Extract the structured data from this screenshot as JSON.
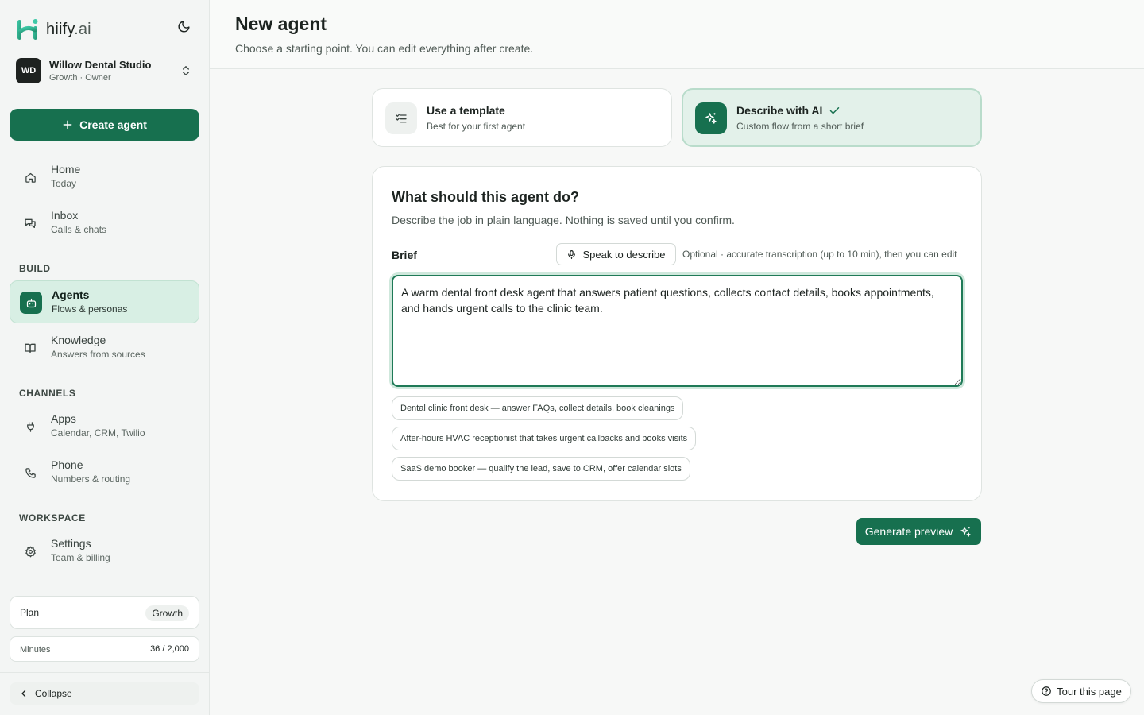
{
  "brand": {
    "name": "hiify",
    "tld": ".ai",
    "accent": "#17704f"
  },
  "workspace": {
    "initials": "WD",
    "name": "Willow Dental Studio",
    "subtitle": "Growth · Owner"
  },
  "sidebar": {
    "create_label": "Create agent",
    "nav": [
      {
        "title": "Home",
        "subtitle": "Today",
        "icon": "home-icon"
      },
      {
        "title": "Inbox",
        "subtitle": "Calls & chats",
        "icon": "chat-icon"
      },
      {
        "title": "Agents",
        "subtitle": "Flows & personas",
        "icon": "bot-icon",
        "active": true
      },
      {
        "title": "Knowledge",
        "subtitle": "Answers from sources",
        "icon": "book-icon"
      },
      {
        "title": "Apps",
        "subtitle": "Calendar, CRM, Twilio",
        "icon": "plug-icon"
      },
      {
        "title": "Phone",
        "subtitle": "Numbers & routing",
        "icon": "phone-icon"
      },
      {
        "title": "Settings",
        "subtitle": "Team & billing",
        "icon": "gear-icon"
      }
    ],
    "sections": {
      "build": "BUILD",
      "channels": "CHANNELS",
      "workspace": "WORKSPACE"
    },
    "plan": {
      "label": "Plan",
      "value": "Growth"
    },
    "minutes": {
      "label": "Minutes",
      "value": "36 / 2,000"
    },
    "collapse_label": "Collapse"
  },
  "header": {
    "title": "New agent",
    "subtitle": "Choose a starting point. You can edit everything after create."
  },
  "modes": [
    {
      "title": "Use a template",
      "subtitle": "Best for your first agent",
      "icon": "checklist-icon",
      "selected": false
    },
    {
      "title": "Describe with AI",
      "subtitle": "Custom flow from a short brief",
      "icon": "sparkle-icon",
      "selected": true
    }
  ],
  "brief": {
    "heading": "What should this agent do?",
    "description": "Describe the job in plain language. Nothing is saved until you confirm.",
    "label": "Brief",
    "speak_label": "Speak to describe",
    "speak_hint": "Optional · accurate transcription (up to 10 min), then you can edit",
    "value": "A warm dental front desk agent that answers patient questions, collects contact details, books appointments, and hands urgent calls to the clinic team.",
    "suggestions": [
      "Dental clinic front desk — answer FAQs, collect details, book cleanings",
      "After-hours HVAC receptionist that takes urgent callbacks and books visits",
      "SaaS demo booker — qualify the lead, save to CRM, offer calendar slots"
    ]
  },
  "generate_label": "Generate preview",
  "tour_label": "Tour this page"
}
